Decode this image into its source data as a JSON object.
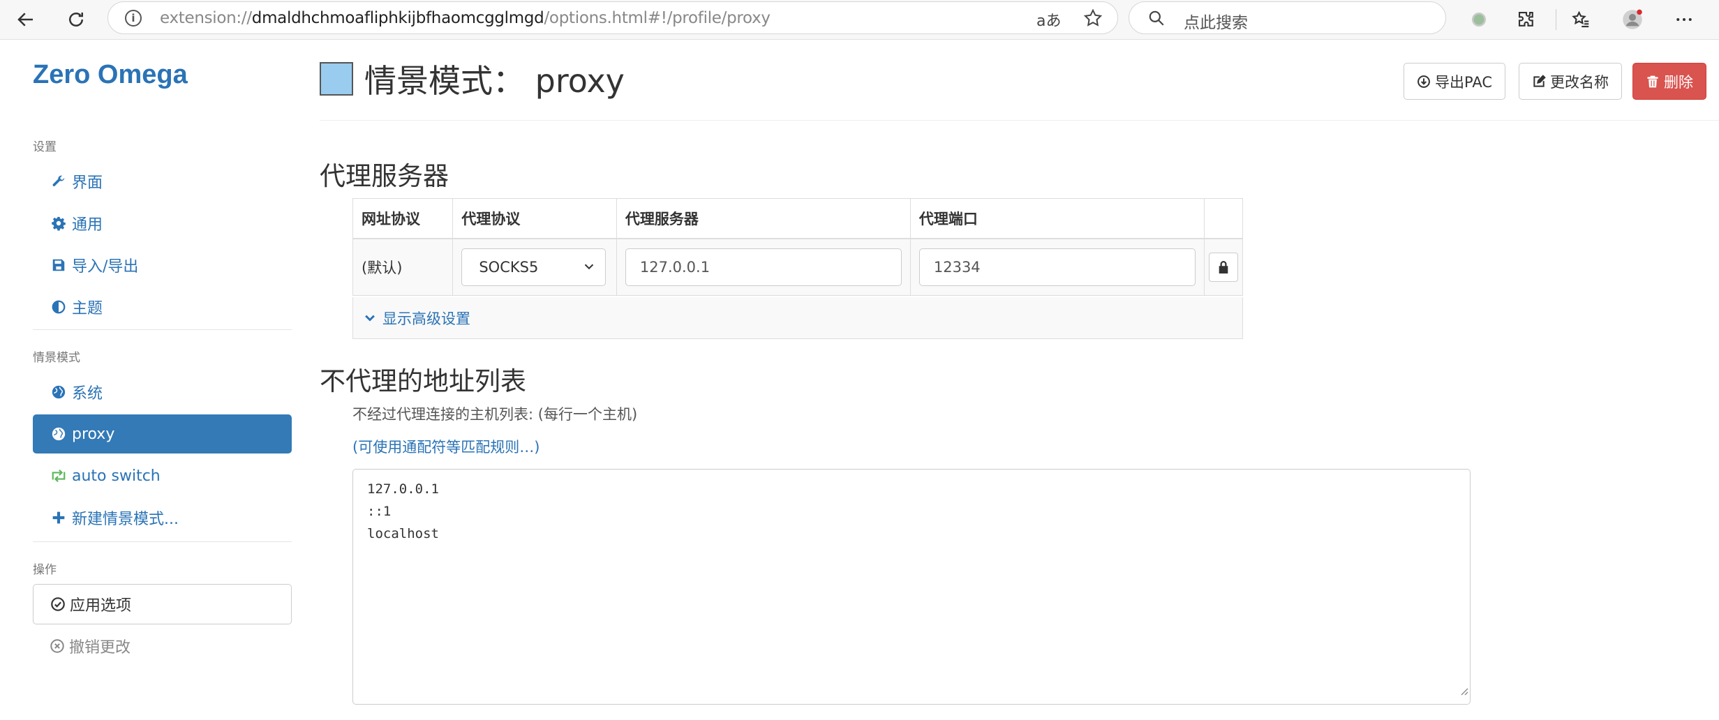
{
  "browser": {
    "url_prefix": "extension://",
    "url_domain": "dmaldhchmoafliphkijbfhaomcgglmgd",
    "url_path": "/options.html#!/profile/proxy",
    "read_aloud_label": "aあ",
    "search_placeholder": "点此搜索"
  },
  "sidebar": {
    "brand": "Zero Omega",
    "settings_header": "设置",
    "settings_items": [
      {
        "label": "界面",
        "icon": "wrench-icon"
      },
      {
        "label": "通用",
        "icon": "gear-icon"
      },
      {
        "label": "导入/导出",
        "icon": "floppy-icon"
      },
      {
        "label": "主题",
        "icon": "contrast-icon"
      }
    ],
    "profiles_header": "情景模式",
    "profile_items": [
      {
        "label": "系统",
        "icon": "globe-icon"
      },
      {
        "label": "proxy",
        "icon": "globe-icon",
        "active": true
      },
      {
        "label": "auto switch",
        "icon": "retweet-icon"
      },
      {
        "label": "新建情景模式...",
        "icon": "plus-icon"
      }
    ],
    "actions_header": "操作",
    "apply_label": "应用选项",
    "revert_label": "撤销更改"
  },
  "header": {
    "title": "情景模式：  proxy",
    "profile_color": "#99ccee",
    "export_pac_label": "导出PAC",
    "rename_label": "更改名称",
    "delete_label": "删除"
  },
  "proxy_section": {
    "title": "代理服务器",
    "columns": [
      "网址协议",
      "代理协议",
      "代理服务器",
      "代理端口"
    ],
    "row": {
      "scheme": "(默认)",
      "protocol": "SOCKS5",
      "server": "127.0.0.1",
      "port": "12334"
    },
    "advanced_label": "显示高级设置"
  },
  "bypass_section": {
    "title": "不代理的地址列表",
    "help_text": "不经过代理连接的主机列表: (每行一个主机)",
    "wildcard_link": "(可使用通配符等匹配规则…)",
    "list": "127.0.0.1\n::1\nlocalhost"
  },
  "colors": {
    "accent": "#337ab7",
    "link": "#2a73b6",
    "danger": "#d9534f"
  }
}
